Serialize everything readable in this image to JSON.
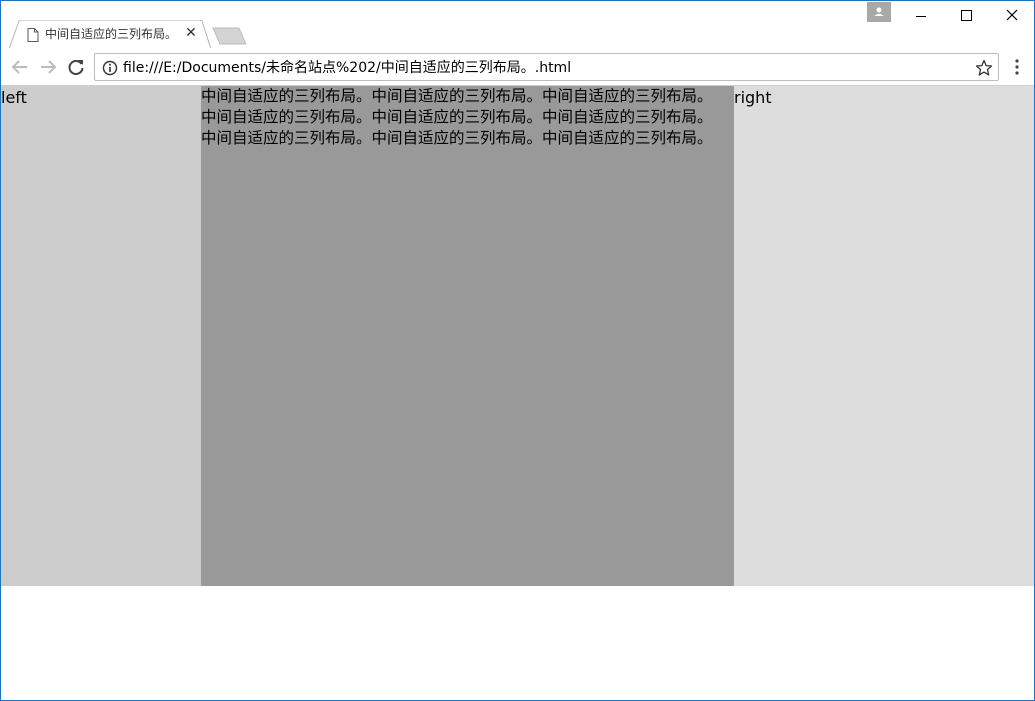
{
  "browser": {
    "tab": {
      "title": "中间自适应的三列布局。",
      "close_glyph": "✕",
      "icon": "page-icon"
    },
    "address_bar": {
      "url": "file:///E:/Documents/未命名站点%202/中间自适应的三列布局。.html",
      "info_icon": "info-icon",
      "bookmark_icon": "star-icon"
    },
    "nav": {
      "back_icon": "back-arrow-icon",
      "forward_icon": "forward-arrow-icon",
      "reload_icon": "reload-icon",
      "menu_icon": "kebab-menu-icon"
    },
    "window_controls": [
      "minimize",
      "maximize",
      "close"
    ]
  },
  "page": {
    "left": {
      "text": "left",
      "color": "#cccccc"
    },
    "middle": {
      "lines": [
        "中间自适应的三列布局。中间自适应的三列布局。中间自适应的三列布局。",
        "中间自适应的三列布局。中间自适应的三列布局。中间自适应的三列布局。",
        "中间自适应的三列布局。中间自适应的三列布局。中间自适应的三列布局。"
      ],
      "color": "#999999"
    },
    "right": {
      "text": "right",
      "color": "#dddddd"
    }
  }
}
